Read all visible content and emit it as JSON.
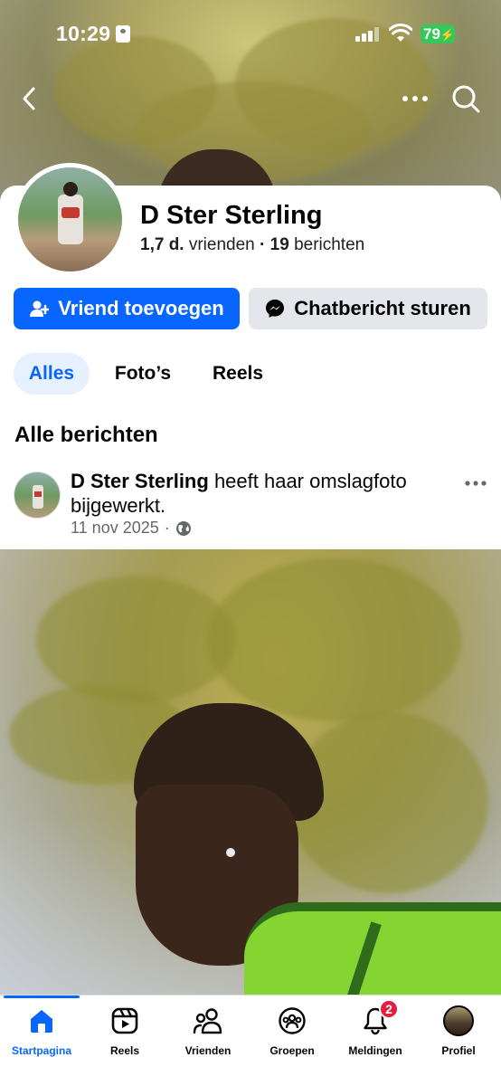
{
  "status_bar": {
    "time": "10:29",
    "battery": "79"
  },
  "profile": {
    "name": "D Ster Sterling",
    "friends_count": "1,7 d.",
    "friends_label": "vrienden",
    "separator": "·",
    "posts_count": "19",
    "posts_label": "berichten"
  },
  "actions": {
    "add_friend": "Vriend toevoegen",
    "message": "Chatbericht sturen"
  },
  "filter_tabs": [
    "Alles",
    "Foto’s",
    "Reels"
  ],
  "section_title": "Alle berichten",
  "post": {
    "author": "D Ster Sterling",
    "action_text": "heeft haar omslagfoto bijgewerkt.",
    "date": "11 nov 2025",
    "separator": "·",
    "privacy_icon": "globe-icon"
  },
  "tabbar": {
    "items": [
      {
        "label": "Startpagina",
        "icon": "home-icon",
        "active": true
      },
      {
        "label": "Reels",
        "icon": "reels-icon"
      },
      {
        "label": "Vrienden",
        "icon": "friends-icon"
      },
      {
        "label": "Groepen",
        "icon": "groups-icon"
      },
      {
        "label": "Meldingen",
        "icon": "bell-icon",
        "badge": "2"
      },
      {
        "label": "Profiel",
        "icon": "profile-avatar"
      }
    ]
  },
  "colors": {
    "accent": "#0866ff",
    "badge": "#e41e3f",
    "battery": "#34c759"
  }
}
